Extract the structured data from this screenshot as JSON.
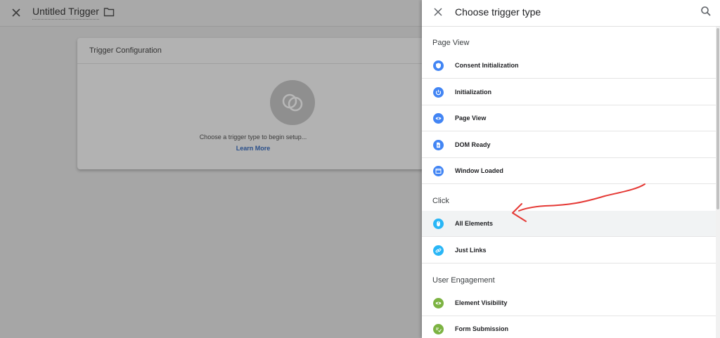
{
  "editor": {
    "title": "Untitled Trigger",
    "card_title": "Trigger Configuration",
    "hint": "Choose a trigger type to begin setup...",
    "learn_more": "Learn More"
  },
  "drawer": {
    "title": "Choose trigger type",
    "sections": [
      {
        "title": "Page View",
        "items": [
          {
            "label": "Consent Initialization",
            "icon": "shield-icon",
            "color": "#4285f4"
          },
          {
            "label": "Initialization",
            "icon": "power-icon",
            "color": "#4285f4"
          },
          {
            "label": "Page View",
            "icon": "eye-icon",
            "color": "#4285f4"
          },
          {
            "label": "DOM Ready",
            "icon": "document-icon",
            "color": "#4285f4"
          },
          {
            "label": "Window Loaded",
            "icon": "window-icon",
            "color": "#4285f4"
          }
        ]
      },
      {
        "title": "Click",
        "items": [
          {
            "label": "All Elements",
            "icon": "mouse-icon",
            "color": "#29b6f6",
            "selected": true
          },
          {
            "label": "Just Links",
            "icon": "link-icon",
            "color": "#29b6f6"
          }
        ]
      },
      {
        "title": "User Engagement",
        "items": [
          {
            "label": "Element Visibility",
            "icon": "eye-icon",
            "color": "#7cb342"
          },
          {
            "label": "Form Submission",
            "icon": "form-icon",
            "color": "#7cb342"
          }
        ]
      }
    ]
  },
  "annotation": {
    "color": "#e53935"
  }
}
